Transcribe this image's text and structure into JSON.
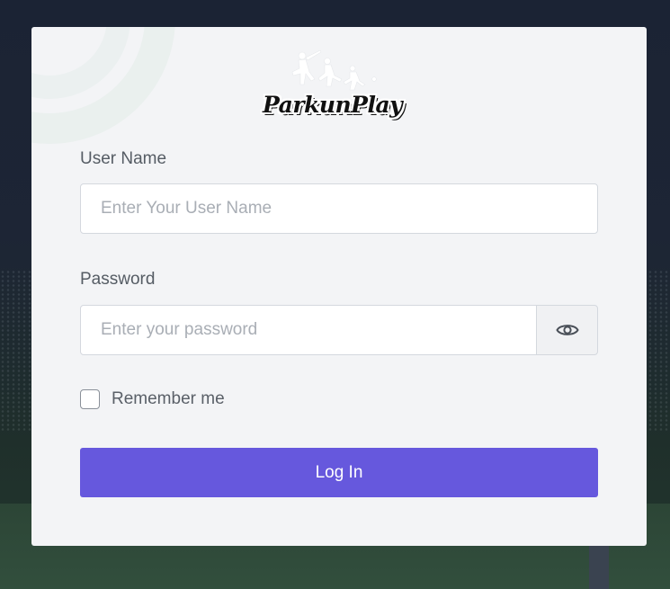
{
  "brand": {
    "logo_text": "ParkunPlay"
  },
  "form": {
    "username_label": "User Name",
    "username_placeholder": "Enter Your User Name",
    "username_value": "",
    "password_label": "Password",
    "password_placeholder": "Enter your password",
    "password_value": "",
    "show_password_icon": "eye-icon",
    "remember_label": "Remember me",
    "remember_checked": false,
    "login_label": "Log In"
  },
  "colors": {
    "primary": "#6658dd",
    "card_background": "#f3f4f6",
    "page_background": "#1d2535"
  }
}
